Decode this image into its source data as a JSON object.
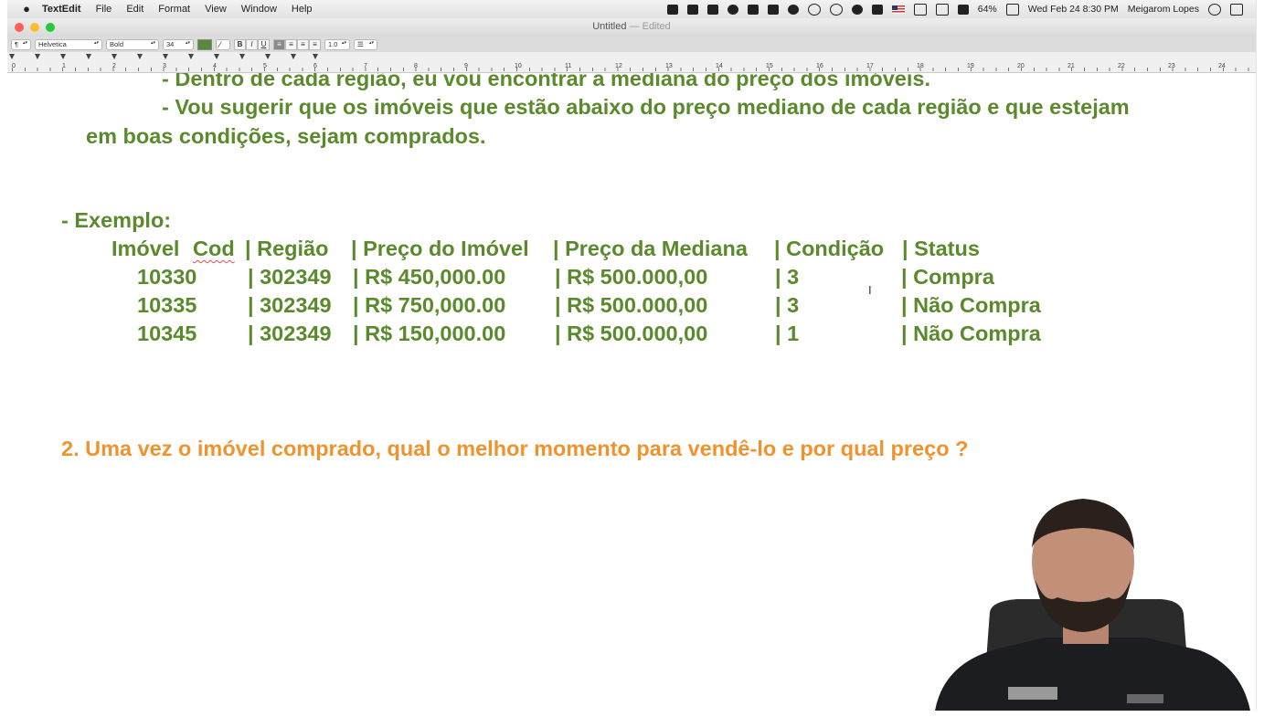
{
  "menubar": {
    "app_name": "TextEdit",
    "items": [
      "File",
      "Edit",
      "Format",
      "View",
      "Window",
      "Help"
    ],
    "battery": "64%",
    "datetime": "Wed Feb 24  8:30 PM",
    "user": "Meigarom Lopes"
  },
  "window": {
    "title": "Untitled",
    "edited_suffix": "— Edited"
  },
  "toolbar": {
    "paragraph_style": "¶",
    "font_family": "Helvetica",
    "font_style": "Bold",
    "font_size": "34",
    "text_color": "#5a8a3a",
    "bold_label": "B",
    "italic_label": "I",
    "underline_label": "U",
    "line_spacing": "1.0",
    "list_label": "☰"
  },
  "ruler": {
    "numbers": [
      "0",
      "1",
      "2",
      "3",
      "4",
      "5",
      "6",
      "7",
      "8",
      "9",
      "10",
      "11",
      "12",
      "13",
      "14",
      "15",
      "16",
      "17",
      "18",
      "19",
      "20",
      "21",
      "22",
      "23",
      "24"
    ]
  },
  "document": {
    "line_partial": "- Dentro de cada região, eu vou encontrar a mediana do preço dos imóveis.",
    "line_suggest_1": "- Vou sugerir que os imóveis que estão abaixo do preço mediano de cada região e que estejam",
    "line_suggest_2": "em boas condições, sejam comprados.",
    "example_label": "- Exemplo:",
    "table": {
      "headers": [
        "Imóvel",
        "Cod",
        "| Região",
        "| Preço do Imóvel",
        "| Preço da Mediana",
        "| Condição",
        "| Status"
      ],
      "rows": [
        [
          "10330",
          "| 302349",
          "| R$ 450,000.00",
          "| R$ 500.000,00",
          "| 3",
          "| Compra"
        ],
        [
          "10335",
          "| 302349",
          "| R$ 750,000.00",
          "| R$ 500.000,00",
          "| 3",
          "| Não Compra"
        ],
        [
          "10345",
          "| 302349",
          "| R$ 150,000.00",
          "| R$ 500.000,00",
          "| 1",
          "| Não Compra"
        ]
      ]
    },
    "question_2": "2. Uma vez o imóvel comprado, qual o melhor momento para vendê-lo e por qual preço ?",
    "text_color": "#5a8a2c",
    "question_color": "#f0922d"
  }
}
